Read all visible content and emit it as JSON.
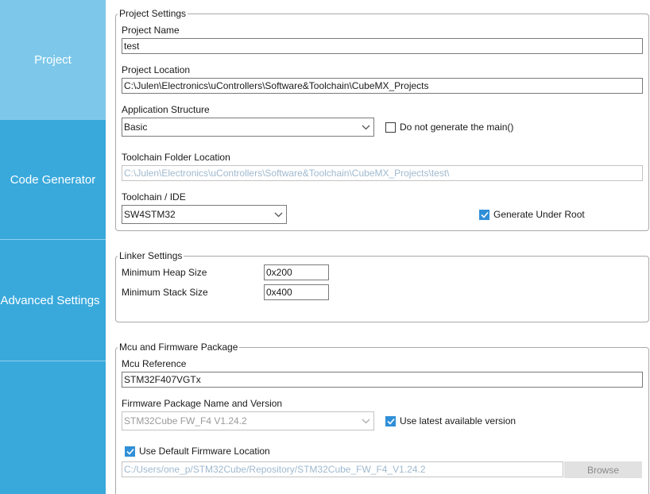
{
  "sidebar": {
    "items": [
      {
        "label": "Project"
      },
      {
        "label": "Code Generator"
      },
      {
        "label": "Advanced Settings"
      }
    ]
  },
  "project_settings": {
    "legend": "Project Settings",
    "project_name_label": "Project Name",
    "project_name_value": "test",
    "project_location_label": "Project Location",
    "project_location_value": "C:\\Julen\\Electronics\\uControllers\\Software&Toolchain\\CubeMX_Projects",
    "app_structure_label": "Application Structure",
    "app_structure_value": "Basic",
    "no_main_label": "Do not generate the main()",
    "no_main_checked": false,
    "toolchain_folder_label": "Toolchain Folder Location",
    "toolchain_folder_value": "C:\\Julen\\Electronics\\uControllers\\Software&Toolchain\\CubeMX_Projects\\test\\",
    "toolchain_ide_label": "Toolchain / IDE",
    "toolchain_ide_value": "SW4STM32",
    "generate_under_root_label": "Generate Under Root",
    "generate_under_root_checked": true
  },
  "linker_settings": {
    "legend": "Linker Settings",
    "heap_label": "Minimum Heap Size",
    "heap_value": "0x200",
    "stack_label": "Minimum Stack Size",
    "stack_value": "0x400"
  },
  "mcu_package": {
    "legend": "Mcu and Firmware Package",
    "mcu_ref_label": "Mcu Reference",
    "mcu_ref_value": "STM32F407VGTx",
    "fw_pkg_label": "Firmware Package Name and Version",
    "fw_pkg_value": "STM32Cube FW_F4 V1.24.2",
    "latest_label": "Use latest available version",
    "latest_checked": true,
    "default_loc_label": "Use Default Firmware Location",
    "default_loc_checked": true,
    "fw_path_value": "C:/Users/one_p/STM32Cube/Repository/STM32Cube_FW_F4_V1.24.2",
    "browse_label": "Browse"
  },
  "colors": {
    "sidebar_bg": "#39a9dc",
    "sidebar_active": "#7dc8ea",
    "checkbox_checked": "#2f8fd8"
  }
}
